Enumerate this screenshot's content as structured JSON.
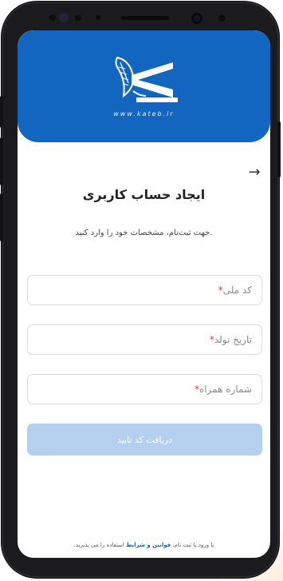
{
  "brand": {
    "url": "www.kateb.ir",
    "primary_color": "#1366bf",
    "disabled_button_color": "#b3d1ef"
  },
  "header": {
    "back_icon": "→"
  },
  "page": {
    "title": "ایجاد حساب کاربری",
    "subtitle": "جهت ثبت‌نام، مشخصات خود را وارد کنید."
  },
  "form": {
    "national_code": {
      "placeholder": "کد ملی",
      "required_mark": "*"
    },
    "birth_date": {
      "placeholder": "تاریخ تولد",
      "required_mark": "*"
    },
    "mobile": {
      "placeholder": "شماره همراه",
      "required_mark": "*"
    },
    "submit_label": "دریافت کد تایید"
  },
  "footer": {
    "prefix": "با ورود یا ثبت نام،",
    "link": "قوانین و شرایط",
    "suffix": "استفاده را می پذیرید."
  }
}
